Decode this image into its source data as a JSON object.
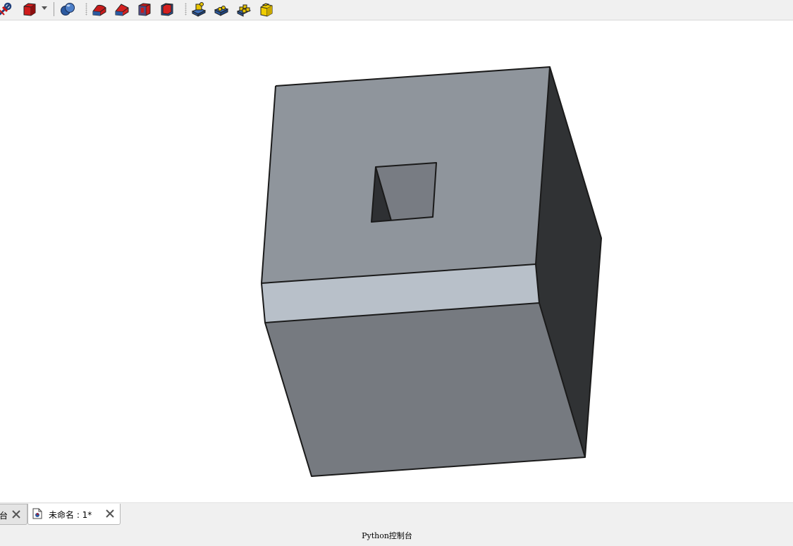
{
  "toolbar": {
    "icons": [
      "std-link-icon",
      "part-box-dropdown-icon",
      "boolean-union-icon",
      "fillet-icon",
      "chamfer-icon",
      "face-make-icon",
      "offset-icon",
      "sketch-attach-icon",
      "sketch-view-icon",
      "part-compound-icon",
      "part-cube-yellow-icon"
    ]
  },
  "viewport": {
    "faces": {
      "top": "#8f959c",
      "hole_floor": "#787c83",
      "hole_wall": "#2e3033",
      "band": "#b8c0c9",
      "front": "#767a80",
      "right": "#303234",
      "edge": "#1a1a1a"
    }
  },
  "tabs": [
    {
      "label": "台",
      "active": false
    },
    {
      "label": "未命名 : 1*",
      "active": true
    }
  ],
  "python_console": {
    "title": "Python控制台"
  }
}
